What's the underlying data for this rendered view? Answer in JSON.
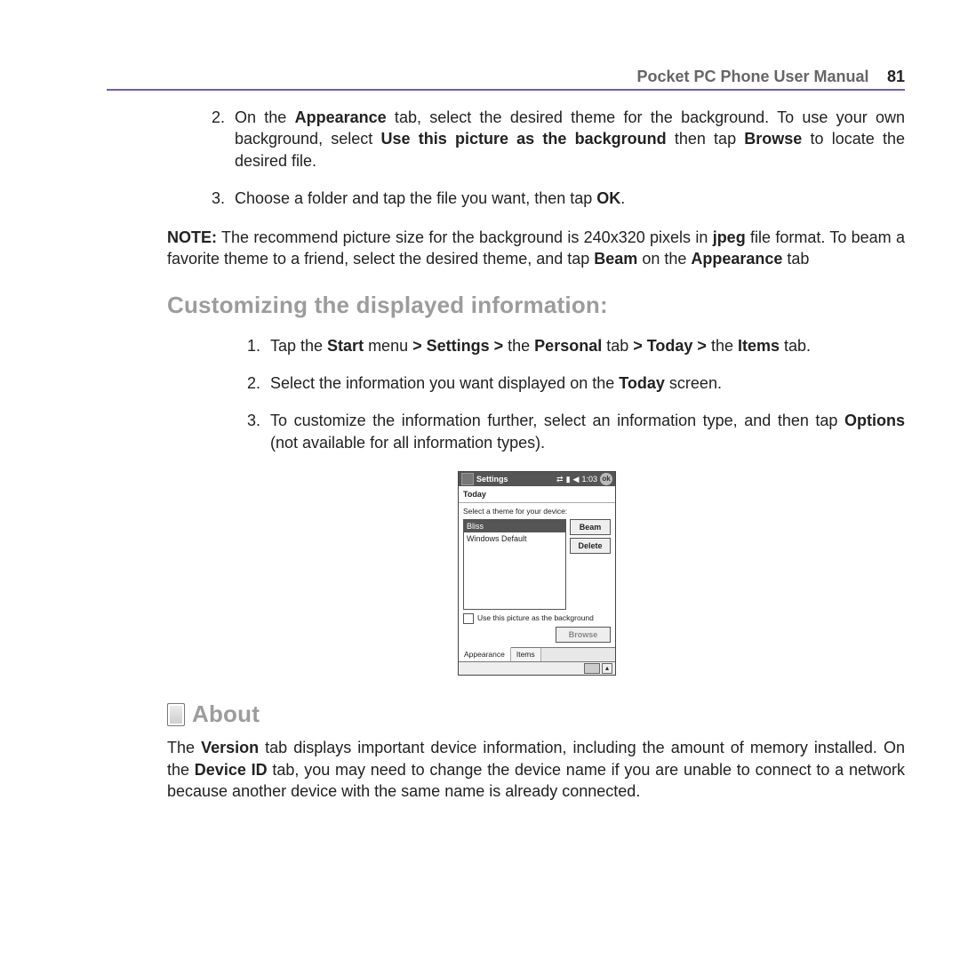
{
  "header": {
    "title": "Pocket PC Phone User Manual",
    "page": "81"
  },
  "step2": {
    "n": "2.",
    "pre": "On the ",
    "b1": "Appearance",
    "mid1": " tab, select the desired theme for the background. To use your own background, select ",
    "b2": "Use this picture as the background",
    "mid2": " then tap ",
    "b3": "Browse",
    "post": " to locate the desired file."
  },
  "step3": {
    "n": "3.",
    "pre": "Choose a folder and tap the file you want, then tap ",
    "b1": "OK",
    "post": "."
  },
  "note": {
    "lead": "NOTE:",
    "t1": " The recommend picture size for the background is 240x320 pixels in ",
    "b1": "jpeg",
    "t2": " file format. To beam a favorite theme to a friend, select the desired theme, and tap ",
    "b2": "Beam",
    "t3": " on the ",
    "b3": "Appearance",
    "t4": " tab"
  },
  "h1": "Customizing the displayed information:",
  "c1": {
    "n": "1.",
    "t1": "Tap the ",
    "b1": "Start",
    "t2": " menu ",
    "b2": "> Settings >",
    "t3": " the ",
    "b3": "Personal",
    "t4": " tab ",
    "b4": "> Today >",
    "t5": " the ",
    "b5": "Items",
    "t6": " tab."
  },
  "c2": {
    "n": "2.",
    "t1": "Select the information you want displayed on the ",
    "b1": "Today",
    "t2": " screen."
  },
  "c3": {
    "n": "3.",
    "t1": "To customize the information further, select an information type, and then tap ",
    "b1": "Options",
    "t2": " (not available for all information types)."
  },
  "ppc": {
    "bar_title": "Settings",
    "time": "1:03",
    "ok": "ok",
    "sub": "Today",
    "label": "Select a theme for your device:",
    "themes": [
      "Bliss",
      "Windows Default"
    ],
    "btn_beam": "Beam",
    "btn_delete": "Delete",
    "chk": "Use this picture as the background",
    "browse": "Browse",
    "tabs": [
      "Appearance",
      "Items"
    ],
    "arrow": "▴"
  },
  "about": {
    "title": "About",
    "p": {
      "t1": "The ",
      "b1": "Version",
      "t2": " tab displays important device information, including the amount of memory installed. On the ",
      "b2": "Device ID",
      "t3": " tab, you may need to change the device name if you are unable to connect to a network because another device with the same name is already connected."
    }
  }
}
